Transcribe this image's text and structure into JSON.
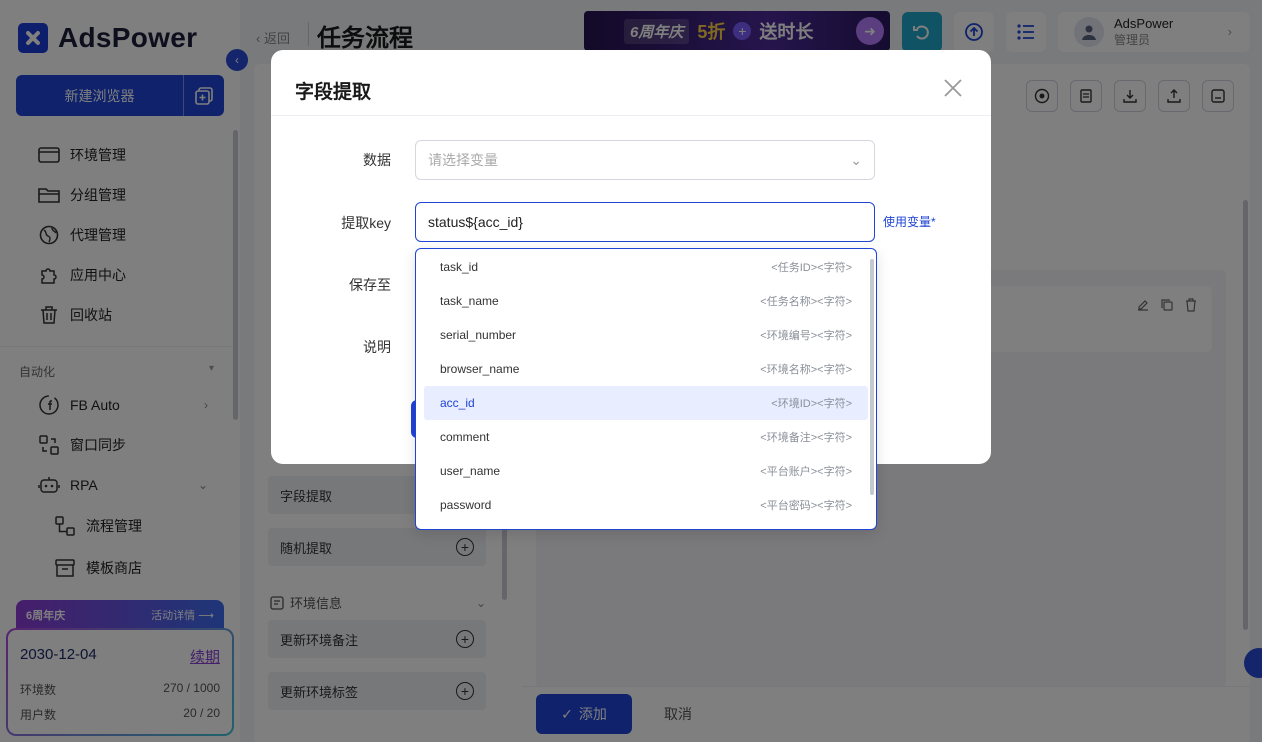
{
  "app": {
    "logo_text": "AdsPower"
  },
  "sidebar": {
    "new_browser": "新建浏览器",
    "items": [
      {
        "label": "环境管理"
      },
      {
        "label": "分组管理"
      },
      {
        "label": "代理管理"
      },
      {
        "label": "应用中心"
      },
      {
        "label": "回收站"
      }
    ],
    "section_automation": "自动化",
    "auto_items": [
      {
        "label": "FB Auto"
      },
      {
        "label": "窗口同步"
      },
      {
        "label": "RPA"
      }
    ],
    "rpa_sub": [
      {
        "label": "流程管理"
      },
      {
        "label": "模板商店"
      }
    ],
    "promo": {
      "title": "6周年庆",
      "link": "活动详情 ⟶"
    },
    "plan": {
      "expiry": "2030-12-04",
      "renew": "续期",
      "env_label": "环境数",
      "env_value": "270 / 1000",
      "user_label": "用户数",
      "user_value": "20 / 20"
    }
  },
  "header": {
    "back": "返回",
    "title": "任务流程",
    "banner": {
      "badge": "6周年庆",
      "offer": "5折",
      "extra": "送时长"
    },
    "user": {
      "name": "AdsPower",
      "role": "管理员"
    }
  },
  "steps": {
    "field_extract": "字段提取",
    "random_extract": "随机提取",
    "group_env_info": "环境信息",
    "update_env_note": "更新环境备注",
    "update_env_tag": "更新环境标签"
  },
  "footer": {
    "add": "添加",
    "cancel": "取消"
  },
  "modal": {
    "title": "字段提取",
    "data_label": "数据",
    "data_placeholder": "请选择变量",
    "key_label": "提取key",
    "key_value": "status${acc_id}",
    "use_variable": "使用变量",
    "save_label": "保存至",
    "desc_label": "说明"
  },
  "dropdown": {
    "options": [
      {
        "key": "task_id",
        "desc": "<任务ID><字符>"
      },
      {
        "key": "task_name",
        "desc": "<任务名称><字符>"
      },
      {
        "key": "serial_number",
        "desc": "<环境编号><字符>"
      },
      {
        "key": "browser_name",
        "desc": "<环境名称><字符>"
      },
      {
        "key": "acc_id",
        "desc": "<环境ID><字符>"
      },
      {
        "key": "comment",
        "desc": "<环境备注><字符>"
      },
      {
        "key": "user_name",
        "desc": "<平台账户><字符>"
      },
      {
        "key": "password",
        "desc": "<平台密码><字符>"
      }
    ],
    "highlighted": "acc_id"
  },
  "colors": {
    "primary": "#1f44d6",
    "highlight_bg": "#e8edff"
  }
}
